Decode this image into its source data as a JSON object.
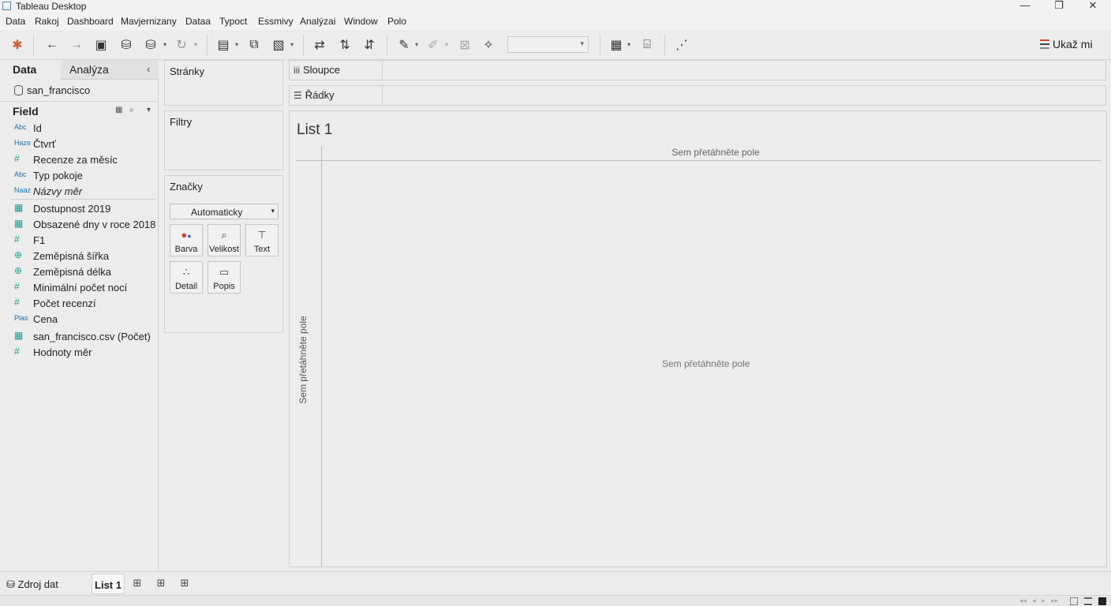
{
  "window": {
    "title": "Tableau Desktop",
    "controls": {
      "minimize": "—",
      "restore": "❐",
      "close": "✕"
    }
  },
  "menu": [
    "Data",
    "Rakoj",
    "Dashboard",
    "Mavjernizany",
    "Dataa",
    "Typoct",
    "Essmivy",
    "Analýzai",
    "Window",
    "Polo"
  ],
  "toolbar": {
    "show_me": "Ukaž mi",
    "combo_value": ""
  },
  "data_pane": {
    "tabs": {
      "data": "Data",
      "analysis": "Analýza"
    },
    "collapse": "‹",
    "datasource": "san_francisco",
    "field_header": "Field",
    "dimensions": [
      {
        "type": "Abc",
        "name": "Id",
        "italic": false
      },
      {
        "type": "Haze",
        "name": "Čtvrť",
        "italic": false
      },
      {
        "type": "#",
        "name": "Recenze za měsíc",
        "italic": false
      },
      {
        "type": "Abc",
        "name": "Typ pokoje",
        "italic": false
      },
      {
        "type": "Naaz",
        "name": "Názvy měr",
        "italic": true
      }
    ],
    "measures": [
      {
        "type": "grid",
        "name": "Dostupnost 2019"
      },
      {
        "type": "grid",
        "name": "Obsazené dny v roce 2018"
      },
      {
        "type": "#",
        "name": "F1"
      },
      {
        "type": "globe",
        "name": "Zeměpisná šířka"
      },
      {
        "type": "globe",
        "name": "Zeměpisná délka"
      },
      {
        "type": "#",
        "name": "Minimální počet nocí"
      },
      {
        "type": "#",
        "name": "Počet recenzí"
      },
      {
        "type": "Plas",
        "name": "Cena"
      },
      {
        "type": "grid",
        "name": "san_francisco.csv (Počet)"
      },
      {
        "type": "#",
        "name": "Hodnoty měr"
      }
    ]
  },
  "cards": {
    "pages": "Stránky",
    "filters": "Filtry",
    "marks": {
      "title": "Značky",
      "mark_type": "Automaticky",
      "buttons": [
        "Barva",
        "Velikost",
        "Text",
        "Detail",
        "Popis"
      ]
    }
  },
  "shelves": {
    "columns": "Sloupce",
    "rows": "Řádky",
    "columns_glyph": "iii",
    "rows_glyph": "☰"
  },
  "view": {
    "sheet_title": "List 1",
    "columns_drop": "Sem přetáhněte pole",
    "rows_drop": "Sem přetáhněte pole",
    "center_drop": "Sem přetáhněte pole"
  },
  "bottom": {
    "data_source_tab": "Zdroj dat",
    "sheet_tab": "List 1"
  },
  "colors": {
    "accent_showme": "#d04a2c",
    "dimension_blue": "#1c6fa8",
    "measure_green": "#17a58b"
  }
}
